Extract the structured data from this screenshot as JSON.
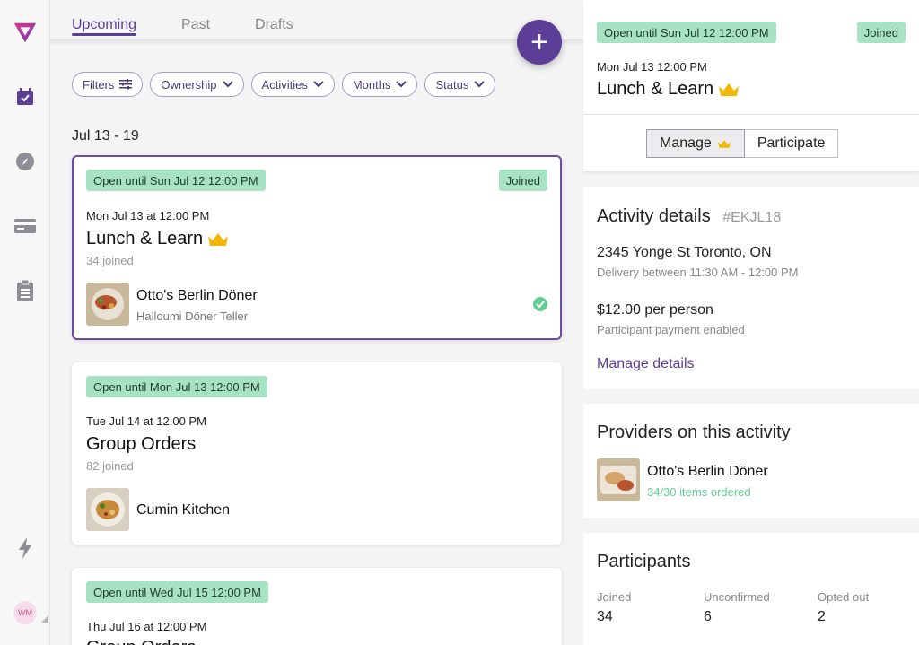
{
  "colors": {
    "accent": "#5b3e96",
    "badge_bg": "#a7e3c3",
    "success": "#5fcf93"
  },
  "tabs": [
    {
      "label": "Upcoming",
      "active": true
    },
    {
      "label": "Past",
      "active": false
    },
    {
      "label": "Drafts",
      "active": false
    }
  ],
  "filters": [
    "Filters",
    "Ownership",
    "Activities",
    "Months",
    "Status"
  ],
  "week_label": "Jul 13 - 19",
  "cards": [
    {
      "badge": "Open until Sun Jul 12 12:00 PM",
      "status": "Joined",
      "date": "Mon Jul 13 at 12:00 PM",
      "title": "Lunch & Learn",
      "joined": "34 joined",
      "vendor": "Otto's Berlin Döner",
      "vendor_sub": "Halloumi Döner Teller"
    },
    {
      "badge": "Open until Mon Jul 13 12:00 PM",
      "date": "Tue Jul 14 at 12:00 PM",
      "title": "Group Orders",
      "joined": "82 joined",
      "vendor": "Cumin Kitchen"
    },
    {
      "badge": "Open until Wed Jul 15 12:00 PM",
      "date": "Thu Jul 16 at 12:00 PM",
      "title": "Group Orders"
    }
  ],
  "detail": {
    "badge": "Open until Sun Jul 12 12:00 PM",
    "status": "Joined",
    "date": "Mon Jul 13 12:00 PM",
    "title": "Lunch & Learn",
    "manage_label": "Manage",
    "participate_label": "Participate"
  },
  "activity": {
    "heading": "Activity details",
    "code": "#EKJL18",
    "address": "2345 Yonge St Toronto, ON",
    "delivery": "Delivery between 11:30 AM - 12:00 PM",
    "price": "$12.00 per person",
    "payment": "Participant payment enabled",
    "manage_link": "Manage details"
  },
  "providers": {
    "heading": "Providers on this activity",
    "name": "Otto's Berlin Döner",
    "ordered": "34/30 items ordered"
  },
  "participants": {
    "heading": "Participants",
    "stats": [
      {
        "label": "Joined",
        "value": "34"
      },
      {
        "label": "Unconfirmed",
        "value": "6"
      },
      {
        "label": "Opted out",
        "value": "2"
      }
    ]
  },
  "user": {
    "initials": "WM"
  }
}
